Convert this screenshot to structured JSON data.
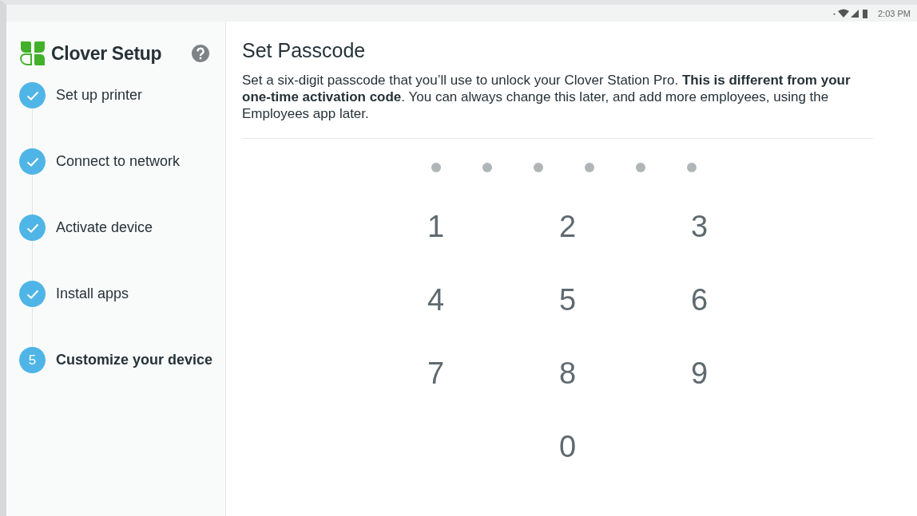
{
  "status_bar": {
    "time": "2:03 PM"
  },
  "sidebar": {
    "title": "Clover Setup",
    "steps": [
      {
        "label": "Set up printer",
        "done": true
      },
      {
        "label": "Connect to network",
        "done": true
      },
      {
        "label": "Activate device",
        "done": true
      },
      {
        "label": "Install apps",
        "done": true
      },
      {
        "label": "Customize your device",
        "done": false,
        "number": "5"
      }
    ]
  },
  "main": {
    "title": "Set Passcode",
    "description": "Set a six-digit passcode that you’ll use to unlock your Clover Station Pro. **This is different from your one-time activation code**. You can always change this later, and add more employees, using the Employees app later.",
    "dots": [
      {
        "filled": false
      },
      {
        "filled": false
      },
      {
        "filled": false
      },
      {
        "filled": false
      },
      {
        "filled": false
      },
      {
        "filled": false
      }
    ],
    "keys": [
      "1",
      "2",
      "3",
      "4",
      "5",
      "6",
      "7",
      "8",
      "9",
      "0"
    ]
  }
}
